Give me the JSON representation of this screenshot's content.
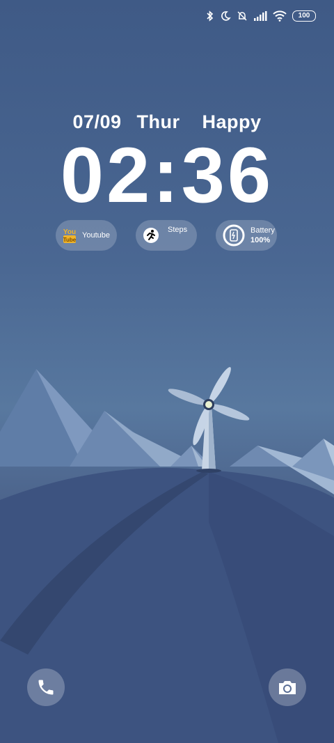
{
  "status_bar": {
    "icons": [
      "bluetooth-icon",
      "moon-icon",
      "bell-off-icon",
      "signal-icon",
      "wifi-icon"
    ],
    "battery_level": "100"
  },
  "lock_screen": {
    "date": "07/09",
    "weekday": "Thur",
    "greeting": "Happy",
    "time": "02:36"
  },
  "widgets": [
    {
      "icon": "youtube-icon",
      "label": "Youtube"
    },
    {
      "icon": "running-person-icon",
      "label": "Steps"
    },
    {
      "icon": "battery-phone-icon",
      "label": "Battery",
      "value": "100%"
    }
  ],
  "bottom_actions": {
    "left": "phone-icon",
    "right": "camera-icon"
  },
  "colors": {
    "sky_top": "#3f5a86",
    "sky_mid": "#58789f",
    "hill": "#3d5380",
    "mountain_light": "#8ea6c5",
    "youtube_yellow": "#f0b429"
  }
}
